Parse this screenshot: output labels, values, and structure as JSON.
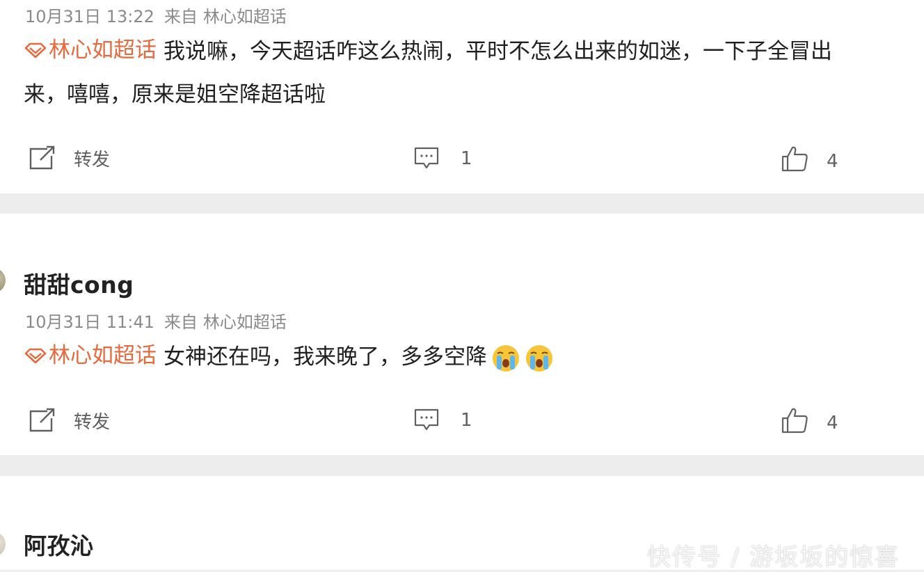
{
  "posts": [
    {
      "username": "",
      "date": "10月31日 13:22",
      "from_label": "来自",
      "source": "林心如超话",
      "topic": "林心如超话",
      "text_line1": "我说嘛，今天超话咋这么热闹，平时不怎么出来的如迷，一下子全冒出",
      "text_line2": "来，嘻嘻，原来是姐空降超话啦",
      "repost_label": "转发",
      "comment_count": "1",
      "like_count": "4"
    },
    {
      "username": "甜甜cong",
      "date": "10月31日 11:41",
      "from_label": "来自",
      "source": "林心如超话",
      "topic": "林心如超话",
      "text_line1": "女神还在吗，我来晚了，多多空降",
      "repost_label": "转发",
      "comment_count": "1",
      "like_count": "4",
      "emojis": [
        "crying-face-icon",
        "crying-face-icon"
      ]
    },
    {
      "username": "阿孜沁"
    }
  ],
  "watermark": "快传号 / 游坂坂的惊喜",
  "colors": {
    "topic": "#e8693b",
    "separator": "#ededed",
    "text": "#1f1f1f",
    "meta": "#8a8a8a",
    "icon": "#606060"
  }
}
